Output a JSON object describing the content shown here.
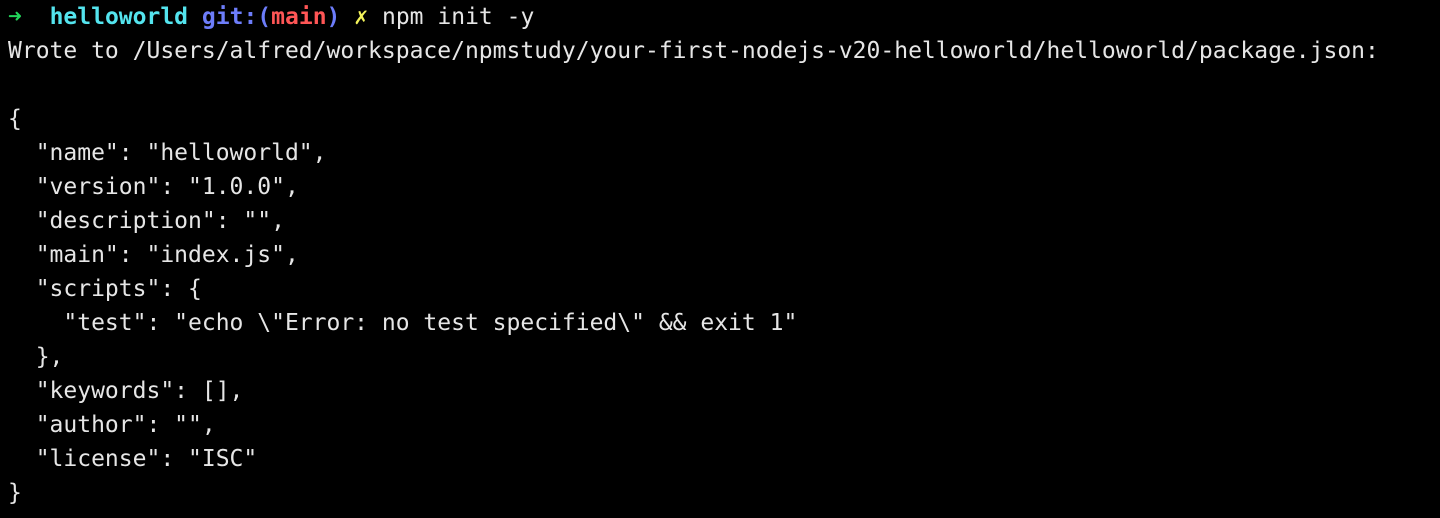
{
  "prompt": {
    "arrow": "➜",
    "directory": "helloworld",
    "git_prefix": "git:(",
    "branch": "main",
    "git_suffix": ")",
    "dirty_marker": "✗",
    "command": "npm init -y"
  },
  "output": {
    "wrote_line": "Wrote to /Users/alfred/workspace/npmstudy/your-first-nodejs-v20-helloworld/helloworld/package.json:",
    "json_lines": [
      "",
      "{",
      "  \"name\": \"helloworld\",",
      "  \"version\": \"1.0.0\",",
      "  \"description\": \"\",",
      "  \"main\": \"index.js\",",
      "  \"scripts\": {",
      "    \"test\": \"echo \\\"Error: no test specified\\\" && exit 1\"",
      "  },",
      "  \"keywords\": [],",
      "  \"author\": \"\",",
      "  \"license\": \"ISC\"",
      "}"
    ]
  },
  "colors": {
    "background": "#000000",
    "foreground": "#e6e6e6",
    "arrow": "#22d55a",
    "directory": "#54e4ee",
    "git": "#6d7dfa",
    "branch": "#ff5656",
    "dirty": "#f3f35b"
  }
}
